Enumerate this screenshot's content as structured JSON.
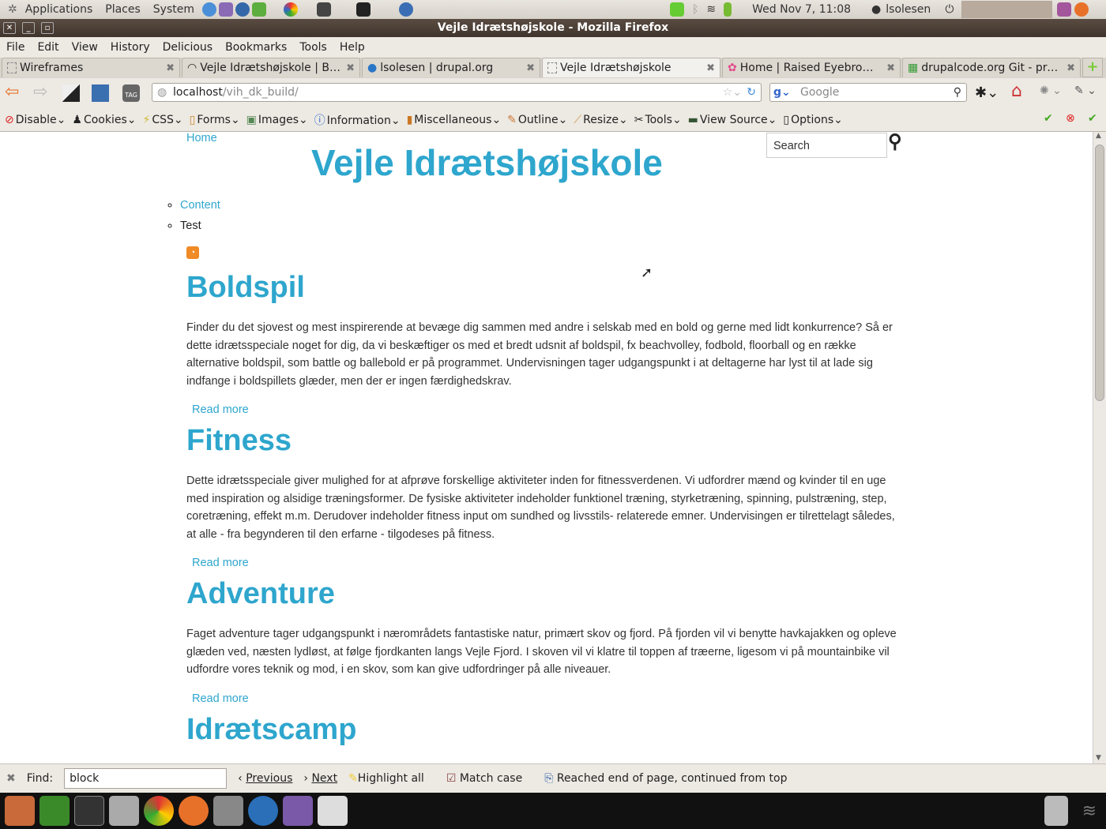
{
  "panel": {
    "menus": [
      "Applications",
      "Places",
      "System"
    ],
    "clock": "Wed Nov  7, 11:08",
    "user": "lsolesen"
  },
  "window": {
    "title": "Vejle Idrætshøjskole - Mozilla Firefox"
  },
  "menubar": [
    "File",
    "Edit",
    "View",
    "History",
    "Delicious",
    "Bookmarks",
    "Tools",
    "Help"
  ],
  "tabs": [
    {
      "label": "Wireframes"
    },
    {
      "label": "Vejle Idrætshøjskole | Bl..."
    },
    {
      "label": "lsolesen | drupal.org"
    },
    {
      "label": "Vejle Idrætshøjskole",
      "active": true
    },
    {
      "label": "Home | Raised Eyebrow ..."
    },
    {
      "label": "drupalcode.org Git - pro..."
    }
  ],
  "navbar": {
    "url_host": "localhost",
    "url_path": "/vih_dk_build/",
    "search_placeholder": "Google"
  },
  "devbar": [
    "Disable",
    "Cookies",
    "CSS",
    "Forms",
    "Images",
    "Information",
    "Miscellaneous",
    "Outline",
    "Resize",
    "Tools",
    "View Source",
    "Options"
  ],
  "page": {
    "home_link": "Home",
    "site_name": "Vejle Idrætshøjskole",
    "search_placeholder": "Search",
    "menu": [
      {
        "label": "Content",
        "link": true
      },
      {
        "label": "Test",
        "link": false
      }
    ],
    "nodes": [
      {
        "title": "Boldspil",
        "body": "Finder du det sjovest og mest inspirerende at bevæge dig sammen med andre i selskab med en bold og gerne med lidt konkurrence? Så er dette idrætsspeciale noget for dig, da vi beskæftiger os med et bredt udsnit af boldspil, fx beachvolley, fodbold, floorball og en række alternative boldspil, som battle og ballebold er på programmet. Undervisningen tager udgangspunkt i at deltagerne har lyst til at lade sig indfange i boldspillets glæder, men der er ingen færdighedskrav.",
        "read_more": "Read more"
      },
      {
        "title": "Fitness",
        "body": "Dette idrætsspeciale giver mulighed for at afprøve forskellige aktiviteter inden for fitnessverdenen. Vi udfordrer mænd og kvinder til en uge med inspiration og alsidige træningsformer. De fysiske aktiviteter indeholder funktionel træning, styrketræning, spinning, pulstræning, step, coretræning, effekt m.m. Derudover indeholder fitness input om sundhed og livsstils- relaterede emner. Undervisingen er tilrettelagt således, at alle - fra begynderen til den erfarne - tilgodeses på fitness.",
        "read_more": "Read more"
      },
      {
        "title": "Adventure",
        "body": "Faget adventure tager udgangspunkt i nærområdets fantastiske natur, primært skov og fjord. På fjorden vil vi benytte havkajakken og opleve glæden ved, næsten lydløst, at følge fjordkanten langs Vejle Fjord. I skoven vil vi klatre til toppen af træerne, ligesom vi på mountainbike vil udfordre vores teknik og mod, i en skov, som kan give udfordringer på alle niveauer.",
        "read_more": "Read more"
      },
      {
        "title": "Idrætscamp",
        "body": "",
        "read_more": ""
      }
    ]
  },
  "findbar": {
    "label": "Find:",
    "value": "block",
    "previous": "Previous",
    "next": "Next",
    "highlight_all": "Highlight all",
    "match_case": "Match case",
    "match_case_checked": true,
    "status": "Reached end of page, continued from top"
  },
  "colors": {
    "link": "#2ea6cd",
    "titlebar": "#4b3f36"
  }
}
